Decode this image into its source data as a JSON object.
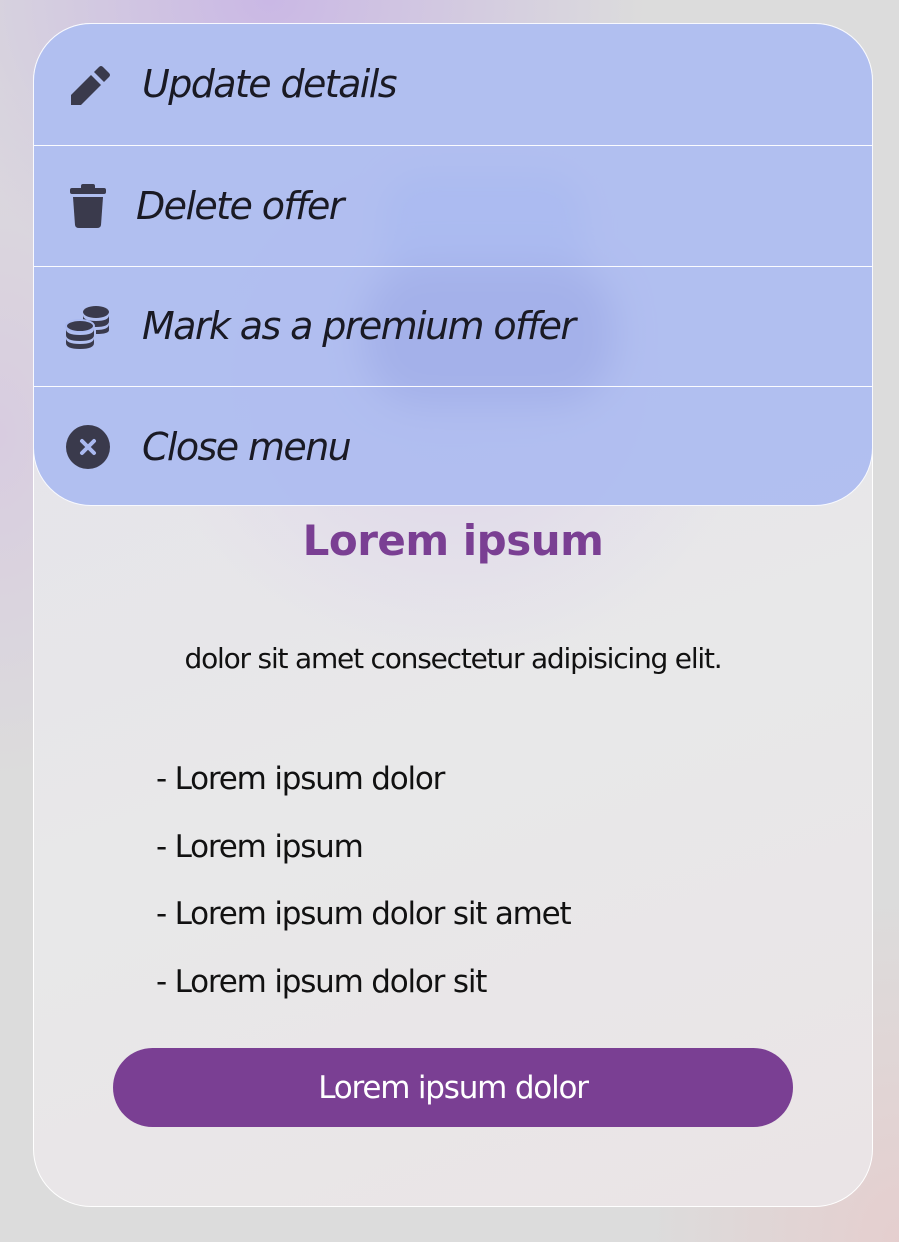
{
  "menu": {
    "items": [
      {
        "label": "Update details",
        "icon": "pencil-icon"
      },
      {
        "label": "Delete offer",
        "icon": "trash-icon"
      },
      {
        "label": "Mark as a premium offer",
        "icon": "coins-icon"
      },
      {
        "label": "Close menu",
        "icon": "close-circle-icon"
      }
    ]
  },
  "card": {
    "title": "Lorem ipsum",
    "description": "dolor sit amet consectetur adipisicing elit.",
    "features": [
      "- Lorem ipsum dolor",
      "- Lorem ipsum",
      "- Lorem ipsum dolor sit amet",
      "- Lorem ipsum dolor sit"
    ],
    "button_label": "Lorem ipsum dolor"
  },
  "colors": {
    "accent": "#7a3f93",
    "menu_background": "#aab9f0",
    "icon": "#3a3a4c"
  }
}
